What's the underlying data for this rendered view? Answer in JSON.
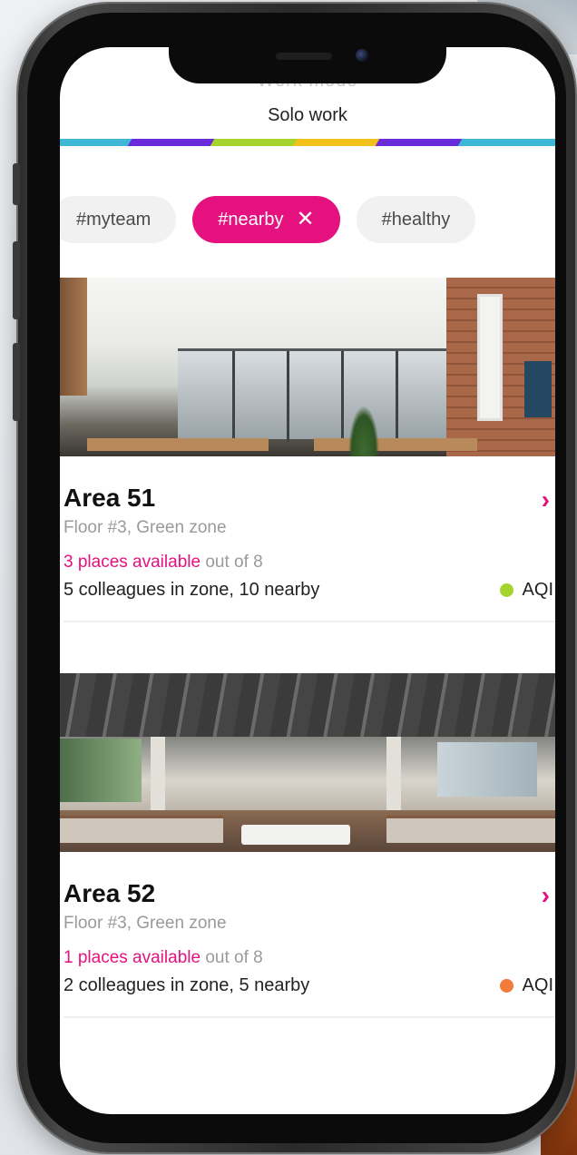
{
  "header": {
    "ghost_title": "Work mode",
    "title": "Solo work"
  },
  "colors": {
    "accent": "#e4117f",
    "stripe": [
      "#3fb7d6",
      "#6a2bd9",
      "#a6d42f",
      "#f2c21a",
      "#6a2bd9",
      "#3fb7d6"
    ],
    "aqi_good": "#a6d42f",
    "aqi_moderate": "#f27b3a"
  },
  "filters": [
    {
      "label": "#myteam",
      "active": false
    },
    {
      "label": "#nearby",
      "active": true,
      "close_icon": "close-icon",
      "close_glyph": "✕"
    },
    {
      "label": "#healthy",
      "active": false
    }
  ],
  "cards": [
    {
      "title": "Area 51",
      "location": "Floor #3, Green zone",
      "available_highlight": "3 places available",
      "available_rest": " out of 8",
      "colleagues": "5 colleagues in zone, 10 nearby",
      "aqi_label": "AQI",
      "aqi_status": "good",
      "chevron": "›",
      "icon": "chevron-right-icon"
    },
    {
      "title": "Area 52",
      "location": "Floor #3, Green zone",
      "available_highlight": "1 places available",
      "available_rest": " out of 8",
      "colleagues": "2 colleagues in zone, 5 nearby",
      "aqi_label": "AQI",
      "aqi_status": "moderate",
      "chevron": "›",
      "icon": "chevron-right-icon"
    }
  ]
}
